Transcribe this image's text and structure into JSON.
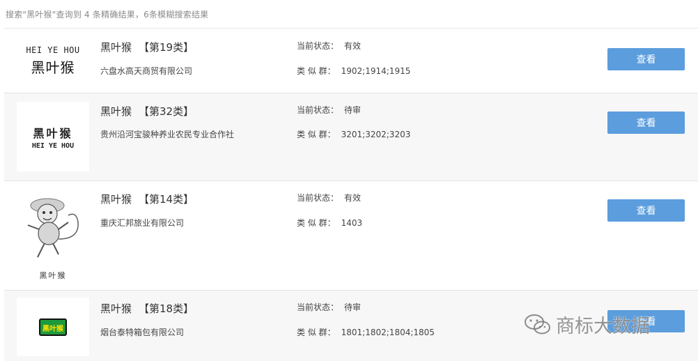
{
  "summary": "搜索\"黑叶猴\"查询到 4 条精确结果，6条模糊搜索结果",
  "status_label": "当前状态：",
  "group_label": "类 似 群：",
  "view_label": "查看",
  "rows": [
    {
      "name": "黑叶猴",
      "class": "【第19类】",
      "company": "六盘水高天商贸有限公司",
      "status": "有效",
      "groups": "1902;1914;1915",
      "logo_en": "HEI YE HOU",
      "logo_cn": "黑叶猴"
    },
    {
      "name": "黑叶猴",
      "class": "【第32类】",
      "company": "贵州沿河宝骏种养业农民专业合作社",
      "status": "待审",
      "groups": "3201;3202;3203",
      "logo_en": "HEI YE HOU",
      "logo_cn": "黑叶猴"
    },
    {
      "name": "黑叶猴",
      "class": "【第14类】",
      "company": "重庆汇邦旅业有限公司",
      "status": "有效",
      "groups": "1403",
      "logo_cn": "黑叶猴"
    },
    {
      "name": "黑叶猴",
      "class": "【第18类】",
      "company": "烟台泰特箱包有限公司",
      "status": "待审",
      "groups": "1801;1802;1804;1805",
      "logo_cn": "黑叶猴"
    }
  ],
  "watermark": "商标大数据",
  "colors": {
    "button": "#5b9ddd",
    "alt_row": "#f7f7f7",
    "logo_green": "#1e9a3c"
  },
  "icons": [
    "wechat-icon",
    "monkey-logo"
  ]
}
